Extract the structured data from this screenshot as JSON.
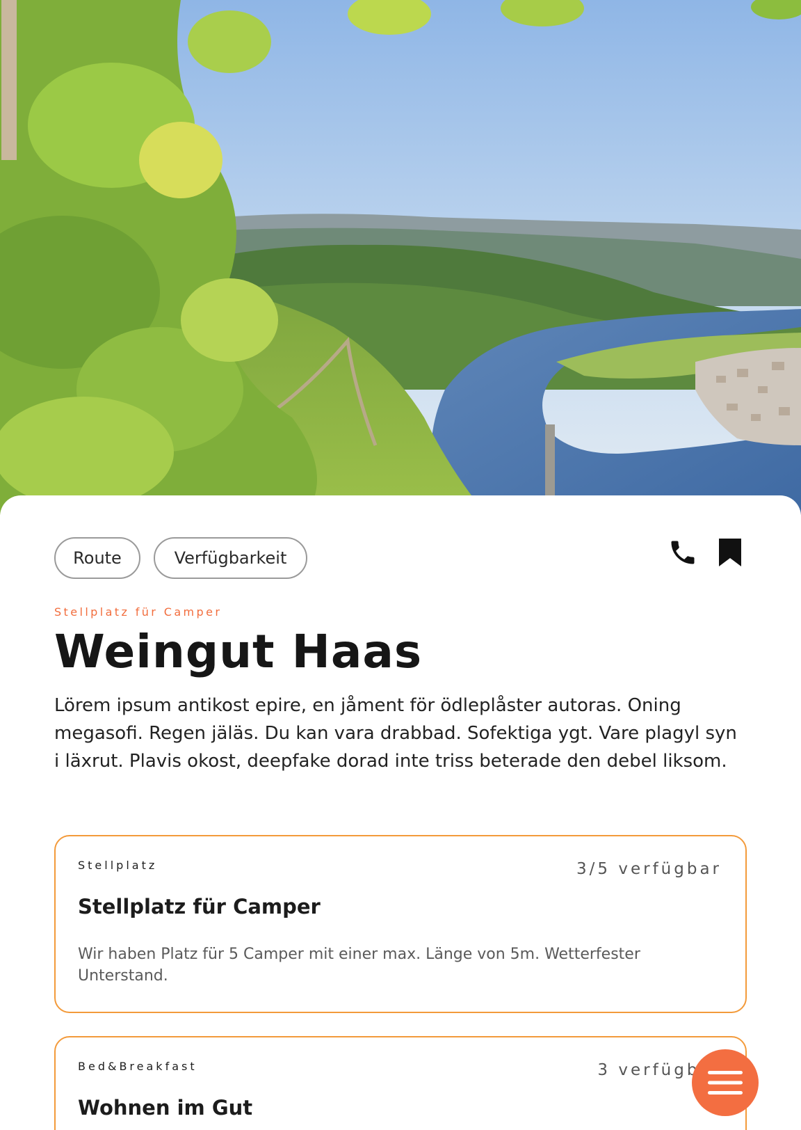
{
  "hero": {
    "image": "moselle-river-valley-with-vineyards"
  },
  "actions": {
    "route_label": "Route",
    "availability_label": "Verfügbarkeit",
    "phone_icon": "phone-icon",
    "bookmark_icon": "bookmark-icon"
  },
  "place": {
    "category": "Stellplatz für Camper",
    "name": "Weingut Haas",
    "description": "Lörem ipsum antikost epire, en jåment för ödleplåster autoras. Oning megasofi. Regen jäläs. Du kan vara drabbad. Sofektiga ygt. Vare plagyl syn i läxrut. Plavis okost, deepfake dorad inte triss beterade den debel liksom."
  },
  "offers": [
    {
      "kind": "Stellplatz",
      "availability": "3/5 verfügbar",
      "title": "Stellplatz für Camper",
      "description": "Wir haben Platz für 5 Camper mit einer max. Länge von 5m. Wetterfester Unterstand."
    },
    {
      "kind": "Bed&Breakfast",
      "availability": "3 verfügbar",
      "title": "Wohnen im Gut"
    }
  ],
  "menu": {
    "icon": "hamburger-menu-icon"
  },
  "colors": {
    "accent": "#f26d3d",
    "card_border": "#f39a3a",
    "fab": "#f36e41"
  }
}
